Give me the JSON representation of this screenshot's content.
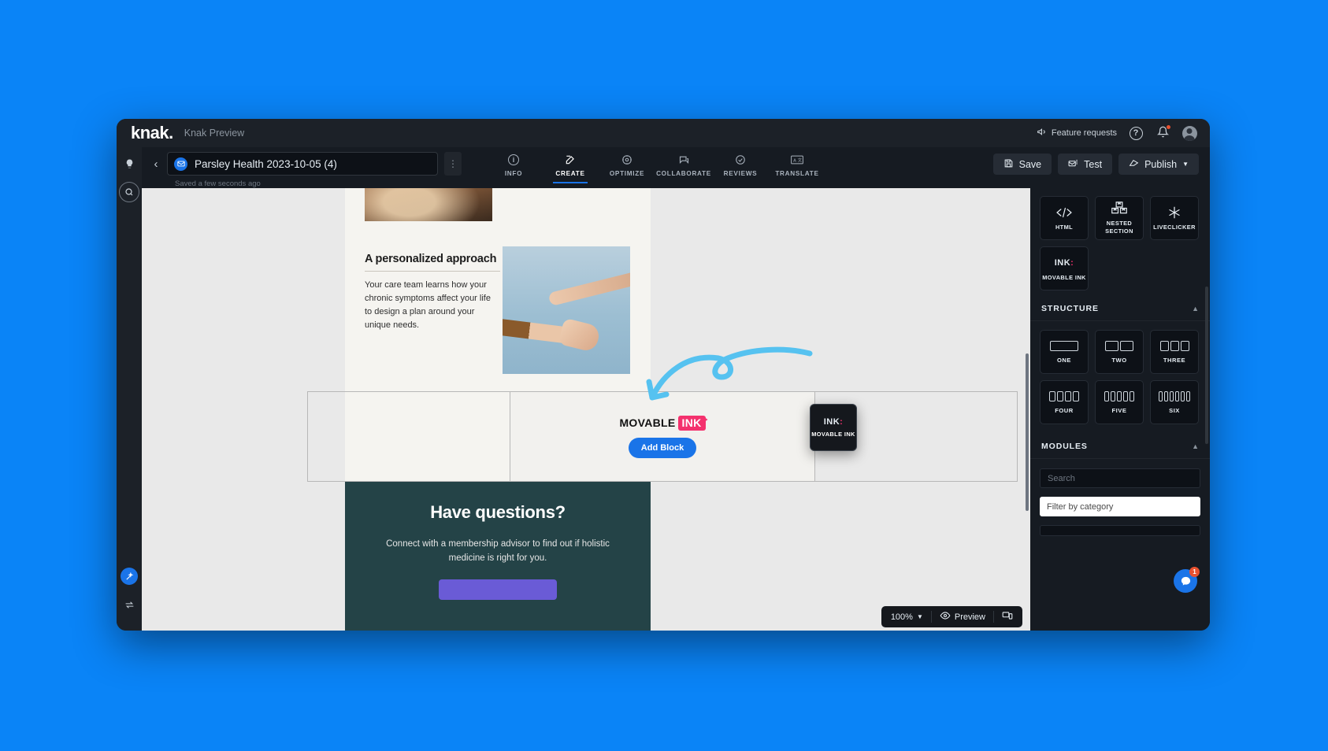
{
  "brand": {
    "logo": "knak.",
    "subtitle": "Knak Preview",
    "feature_requests": "Feature requests",
    "help_icon": "?",
    "bell_icon": "bell-icon",
    "avatar_icon": "avatar-icon"
  },
  "toolbar": {
    "back_icon": "chevron-left-icon",
    "mail_icon": "envelope-icon",
    "doc_title": "Parsley Health 2023-10-05 (4)",
    "saved_note": "Saved a few seconds ago",
    "kebab_icon": "kebab-menu-icon",
    "tabs": [
      {
        "label": "INFO",
        "icon": "info-circle-icon",
        "active": false
      },
      {
        "label": "CREATE",
        "icon": "pencil-square-icon",
        "active": true
      },
      {
        "label": "OPTIMIZE",
        "icon": "gear-circle-icon",
        "active": false
      },
      {
        "label": "COLLABORATE",
        "icon": "comments-icon",
        "active": false
      },
      {
        "label": "REVIEWS",
        "icon": "check-circle-icon",
        "active": false
      },
      {
        "label": "TRANSLATE",
        "icon": "translate-icon",
        "active": false
      }
    ],
    "save_label": "Save",
    "test_label": "Test",
    "publish_label": "Publish"
  },
  "left_rail": {
    "items": [
      {
        "icon": "lightbulb-icon"
      },
      {
        "icon": "search-icon"
      }
    ],
    "bottom": [
      {
        "icon": "magic-wand-icon"
      },
      {
        "icon": "swap-arrows-icon"
      }
    ]
  },
  "email": {
    "approach_title": "A personalized approach",
    "approach_body": "Your care team learns how your chronic symptoms affect your life to design a plan around your unique needs.",
    "movable_ink_logo_text": "MOVABLE",
    "movable_ink_logo_mark": "INK",
    "add_block_label": "Add Block",
    "questions_title": "Have questions?",
    "questions_body": "Connect with a membership advisor to find out if holistic medicine is right for you."
  },
  "drag_chip": {
    "mark": "INK",
    "dots": ":",
    "label": "MOVABLE INK"
  },
  "canvas_controls": {
    "undo_icon": "undo-icon",
    "redo_icon": "redo-icon",
    "zoom_level": "100%",
    "zoom_chevron": "chevron-down-icon",
    "preview_icon": "eye-icon",
    "preview_label": "Preview",
    "device_icon": "device-toggle-icon"
  },
  "right_panel": {
    "blocks": [
      {
        "label": "HTML",
        "icon": "code-icon"
      },
      {
        "label": "NESTED SECTION",
        "icon": "boxes-icon"
      },
      {
        "label": "LIVECLICKER",
        "icon": "asterisk-icon"
      },
      {
        "label": "MOVABLE INK",
        "icon": "movable-ink-icon"
      }
    ],
    "structure": {
      "title": "STRUCTURE",
      "collapse_icon": "chevron-up-icon",
      "items": [
        {
          "label": "ONE",
          "cols": 1
        },
        {
          "label": "TWO",
          "cols": 2
        },
        {
          "label": "THREE",
          "cols": 3
        },
        {
          "label": "FOUR",
          "cols": 4
        },
        {
          "label": "FIVE",
          "cols": 5
        },
        {
          "label": "SIX",
          "cols": 6
        }
      ]
    },
    "modules": {
      "title": "MODULES",
      "collapse_icon": "chevron-up-icon",
      "search_placeholder": "Search",
      "filter_placeholder": "Filter by category"
    }
  },
  "intercom": {
    "icon": "chat-icon",
    "badge": "1"
  },
  "colors": {
    "page_background": "#0a84f7",
    "app_background": "#1c2128",
    "panel_background": "#161b22",
    "accent_blue": "#1a74e8",
    "ink_pink": "#f4316d",
    "teal": "#244347",
    "arrow": "#56c2f0"
  }
}
